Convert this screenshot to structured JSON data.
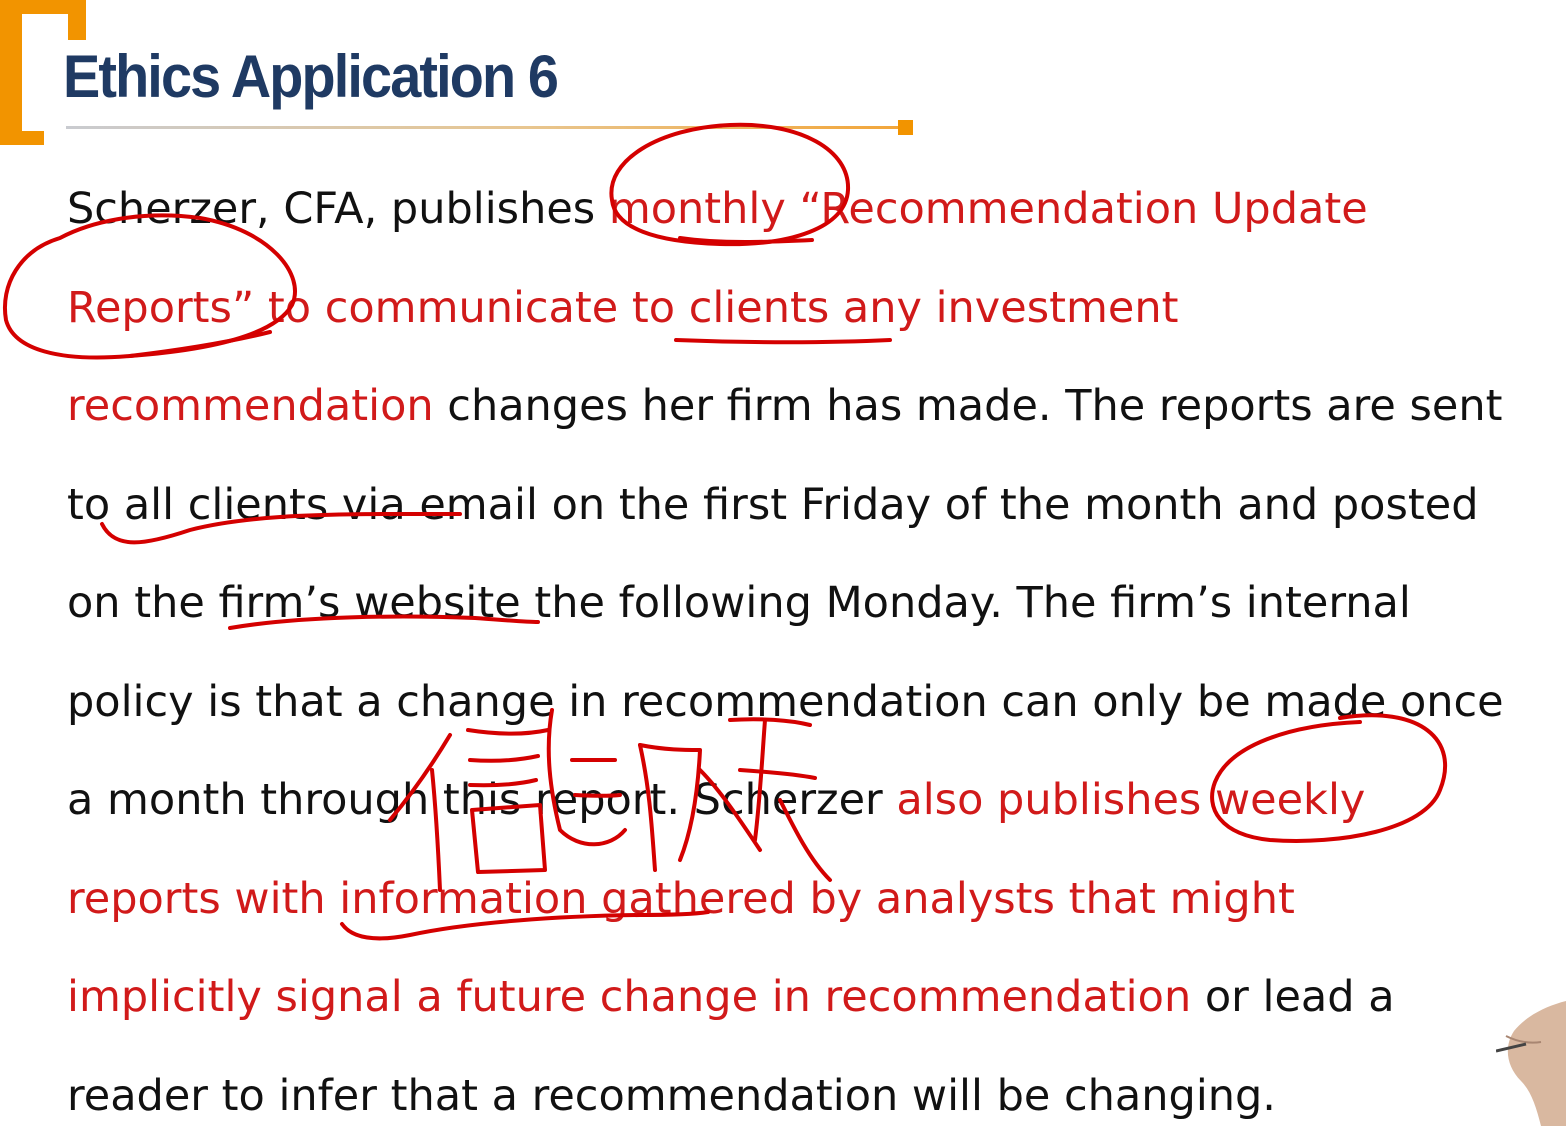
{
  "slide": {
    "title": "Ethics Application 6",
    "accent_color": "#f29400",
    "title_color": "#1f3a63",
    "highlight_color": "#d11a1a"
  },
  "paragraph": {
    "lines": [
      [
        {
          "text": "Scherzer, CFA, publishes ",
          "highlight": false
        },
        {
          "text": "monthly “Recommendation Update",
          "highlight": true
        }
      ],
      [
        {
          "text": "Reports” to communicate to clients any investment",
          "highlight": true
        }
      ],
      [
        {
          "text": "recommendation",
          "highlight": true
        },
        {
          "text": " changes her firm has made. The reports are sent",
          "highlight": false
        }
      ],
      [
        {
          "text": "to all clients via email on the first Friday of the month and posted",
          "highlight": false
        }
      ],
      [
        {
          "text": "on the firm’s website the following Monday. The firm’s internal",
          "highlight": false
        }
      ],
      [
        {
          "text": "policy is that a change in recommendation can only be made once",
          "highlight": false
        }
      ],
      [
        {
          "text": "a month through this report. Scherzer ",
          "highlight": false
        },
        {
          "text": "also publishes weekly",
          "highlight": true
        }
      ],
      [
        {
          "text": "reports with information gathered by analysts that might",
          "highlight": true
        }
      ],
      [
        {
          "text": "implicitly signal a future change in recommendation",
          "highlight": true
        },
        {
          "text": " or lead a",
          "highlight": false
        }
      ],
      [
        {
          "text": "reader to infer that a recommendation will be changing.",
          "highlight": false
        }
      ]
    ]
  },
  "handwriting": {
    "chinese_note": "信息马赛克"
  }
}
